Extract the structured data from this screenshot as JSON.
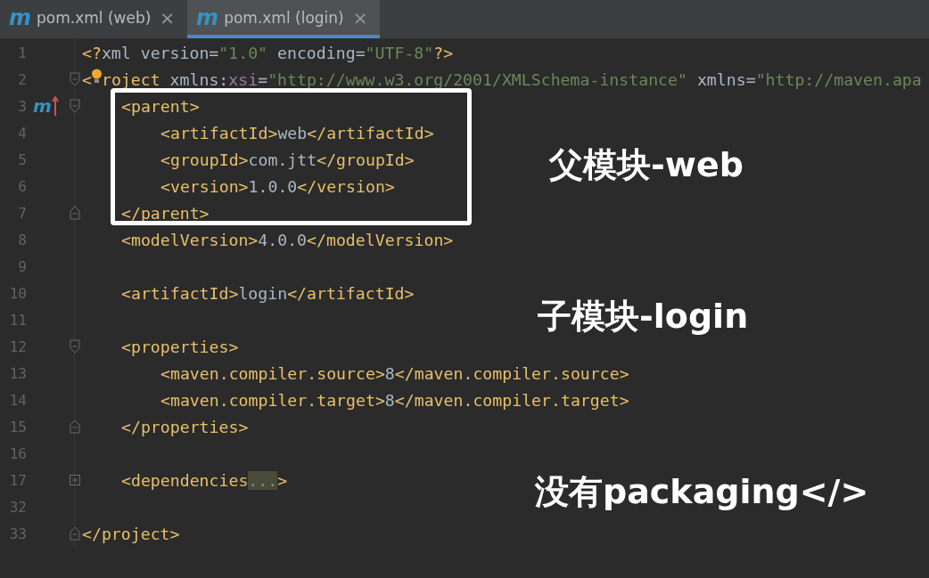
{
  "tabs": [
    {
      "icon": "m",
      "label": "pom.xml (web)",
      "close": "×",
      "selected": false
    },
    {
      "icon": "m",
      "label": "pom.xml (login)",
      "close": "×",
      "selected": true
    }
  ],
  "editor": {
    "lines": [
      {
        "number": "1",
        "tokens": [
          {
            "kind": "tag",
            "text": "<?"
          },
          {
            "kind": "text",
            "text": "xml version"
          },
          {
            "kind": "text",
            "text": "="
          },
          {
            "kind": "str",
            "text": "\"1.0\" "
          },
          {
            "kind": "text",
            "text": "encoding"
          },
          {
            "kind": "text",
            "text": "="
          },
          {
            "kind": "str",
            "text": "\"UTF-8\""
          },
          {
            "kind": "tag",
            "text": "?>"
          }
        ]
      },
      {
        "number": "2",
        "kind": "fold_start",
        "bulb": true,
        "tokens": [
          {
            "kind": "tag",
            "text": "<"
          },
          {
            "kind": "tag",
            "text": "roject "
          },
          {
            "kind": "text",
            "text": "xmlns:"
          },
          {
            "kind": "ns",
            "text": "xsi"
          },
          {
            "kind": "text",
            "text": "="
          },
          {
            "kind": "str",
            "text": "\"http://www.w3.org/2001/XMLSchema-instance\" "
          },
          {
            "kind": "text",
            "text": "xmlns"
          },
          {
            "kind": "text",
            "text": "="
          },
          {
            "kind": "str",
            "text": "\"http://maven.apa"
          }
        ],
        "children": [
          {
            "number": "3",
            "kind": "fold_start",
            "gutter_mark": "m",
            "tokens": [
              {
                "kind": "tag",
                "text": "<parent>"
              }
            ],
            "children": [
              {
                "number": "4",
                "tokens": [
                  {
                    "kind": "tag",
                    "text": "<artifactId>"
                  },
                  {
                    "kind": "text",
                    "text": "web"
                  },
                  {
                    "kind": "tag",
                    "text": "</artifactId>"
                  }
                ]
              },
              {
                "number": "5",
                "tokens": [
                  {
                    "kind": "tag",
                    "text": "<groupId>"
                  },
                  {
                    "kind": "text",
                    "text": "com.jtt"
                  },
                  {
                    "kind": "tag",
                    "text": "</groupId>"
                  }
                ]
              },
              {
                "number": "6",
                "tokens": [
                  {
                    "kind": "tag",
                    "text": "<version>"
                  },
                  {
                    "kind": "text",
                    "text": "1.0.0"
                  },
                  {
                    "kind": "tag",
                    "text": "</version>"
                  }
                ]
              }
            ]
          },
          {
            "number": "7",
            "kind": "fold_end",
            "tokens": [
              {
                "kind": "tag",
                "text": "</parent>"
              }
            ]
          },
          {
            "number": "8",
            "tokens": [
              {
                "kind": "tag",
                "text": "<modelVersion>"
              },
              {
                "kind": "text",
                "text": "4.0.0"
              },
              {
                "kind": "tag",
                "text": "</modelVersion>"
              }
            ]
          },
          {
            "number": "9"
          },
          {
            "number": "10",
            "tokens": [
              {
                "kind": "tag",
                "text": "<artifactId>"
              },
              {
                "kind": "text",
                "text": "login"
              },
              {
                "kind": "tag",
                "text": "</artifactId>"
              }
            ]
          },
          {
            "number": "11"
          },
          {
            "number": "12",
            "kind": "fold_start",
            "tokens": [
              {
                "kind": "tag",
                "text": "<properties>"
              }
            ],
            "children": [
              {
                "number": "13",
                "tokens": [
                  {
                    "kind": "tag",
                    "text": "<maven.compiler.source>"
                  },
                  {
                    "kind": "text",
                    "text": "8"
                  },
                  {
                    "kind": "tag",
                    "text": "</maven.compiler.source>"
                  }
                ]
              },
              {
                "number": "14",
                "tokens": [
                  {
                    "kind": "tag",
                    "text": "<maven.compiler.target>"
                  },
                  {
                    "kind": "text",
                    "text": "8"
                  },
                  {
                    "kind": "tag",
                    "text": "</maven.compiler.target>"
                  }
                ]
              }
            ]
          },
          {
            "number": "15",
            "kind": "fold_end",
            "tokens": [
              {
                "kind": "tag",
                "text": "</properties>"
              }
            ]
          },
          {
            "number": "16"
          },
          {
            "number": "17",
            "kind": "fold_collapsed",
            "tokens": [
              {
                "kind": "tag",
                "text": "<dependencies"
              },
              {
                "kind": "placeholder",
                "text": "..."
              },
              {
                "kind": "tag",
                "text": ">"
              }
            ]
          },
          {
            "number": "32"
          }
        ]
      },
      {
        "number": "33",
        "kind": "fold_end",
        "tokens": [
          {
            "kind": "tag",
            "text": "</project>"
          }
        ]
      }
    ]
  },
  "annotations": [
    {
      "kind": "box"
    },
    {
      "kind": "label",
      "text": "父模块-web"
    },
    {
      "kind": "label",
      "text": "子模块-login"
    },
    {
      "kind": "label",
      "text": "没有packaging</>"
    }
  ]
}
